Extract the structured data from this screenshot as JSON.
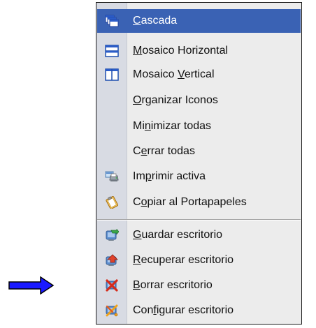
{
  "menu": {
    "items": [
      {
        "pre": "",
        "mn": "C",
        "post": "ascada",
        "icon": "cascade-windows-icon"
      },
      {
        "pre": "",
        "mn": "M",
        "post": "osaico Horizontal",
        "icon": "tile-horizontal-icon"
      },
      {
        "pre": "Mosaico ",
        "mn": "V",
        "post": "ertical",
        "icon": "tile-vertical-icon"
      },
      {
        "pre": "",
        "mn": "O",
        "post": "rganizar Iconos",
        "icon": ""
      },
      {
        "pre": "Mi",
        "mn": "n",
        "post": "imizar todas",
        "icon": ""
      },
      {
        "pre": "C",
        "mn": "e",
        "post": "rrar todas",
        "icon": ""
      },
      {
        "pre": "Im",
        "mn": "p",
        "post": "rimir activa",
        "icon": "print-icon"
      },
      {
        "pre": "C",
        "mn": "o",
        "post": "piar al Portapapeles",
        "icon": "clipboard-icon"
      },
      {
        "pre": "",
        "mn": "G",
        "post": "uardar escritorio",
        "icon": "save-desktop-icon"
      },
      {
        "pre": "",
        "mn": "R",
        "post": "ecuperar escritorio",
        "icon": "restore-desktop-icon"
      },
      {
        "pre": "",
        "mn": "B",
        "post": "orrar escritorio",
        "icon": "delete-desktop-icon"
      },
      {
        "pre": "Con",
        "mn": "f",
        "post": "igurar escritorio",
        "icon": "configure-desktop-icon"
      }
    ]
  },
  "colors": {
    "selected_background": "#3a62b4",
    "menu_background": "#ececec",
    "icon_gutter": "#d8dbe3",
    "pointer_arrow": "#1a1aff"
  }
}
